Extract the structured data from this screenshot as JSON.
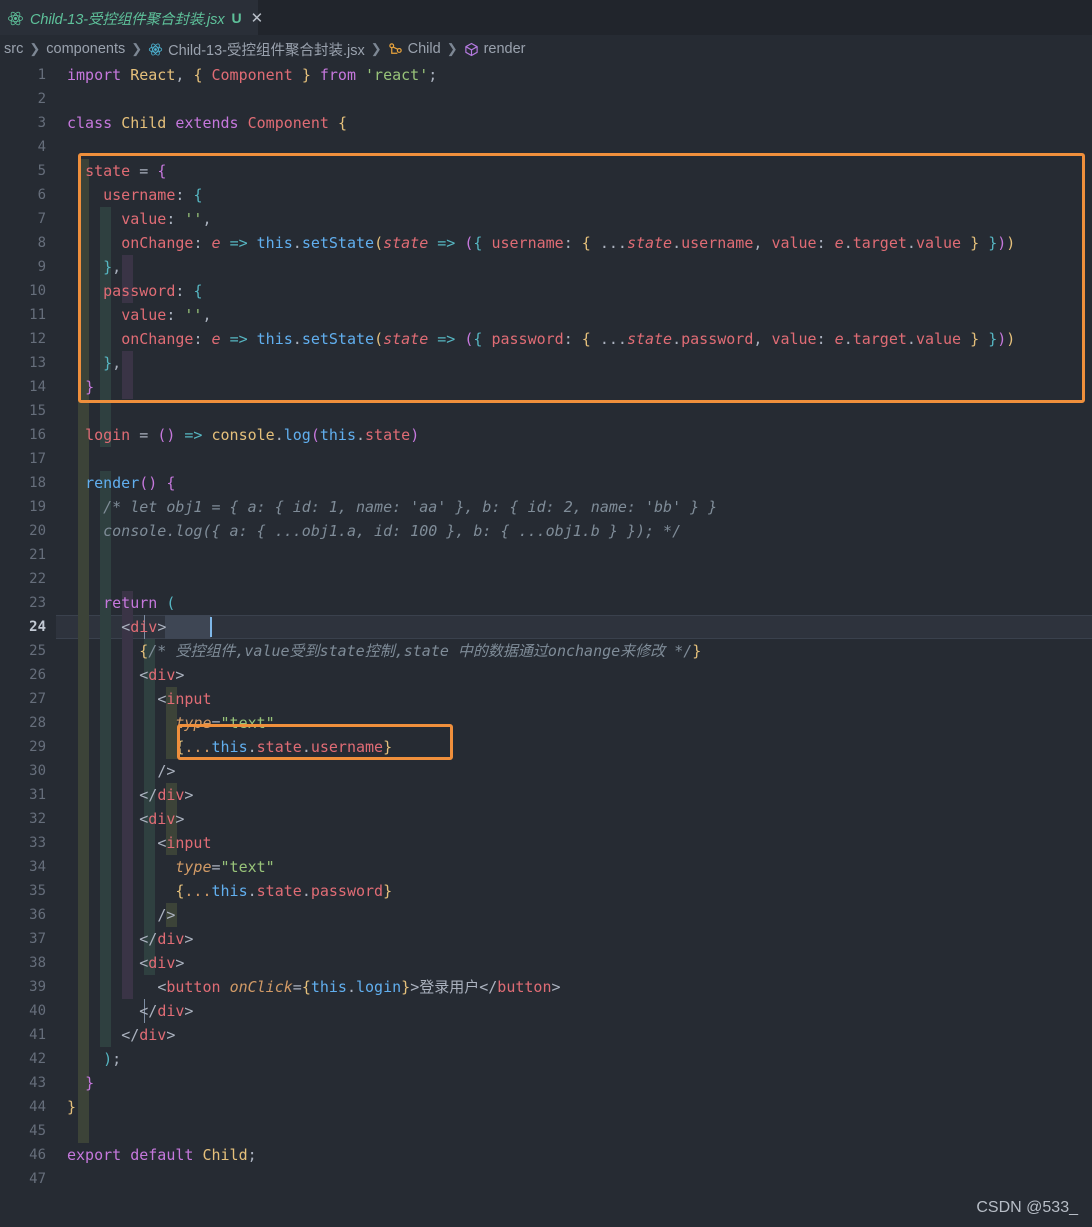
{
  "window": {
    "background": "#262b33",
    "accent_orange": "#ef8f3c"
  },
  "tab": {
    "icon": "react-icon",
    "label": "Child-13-受控组件聚合封装.jsx",
    "git_badge": "U",
    "close_label": "✕",
    "label_color": "#5ec19a"
  },
  "breadcrumb": {
    "items": [
      {
        "label": "src",
        "icon": null
      },
      {
        "label": "components",
        "icon": null
      },
      {
        "label": "Child-13-受控组件聚合封装.jsx",
        "icon": "react-icon"
      },
      {
        "label": "Child",
        "icon": "class-icon"
      },
      {
        "label": "render",
        "icon": "method-icon"
      }
    ],
    "separator": "❯"
  },
  "editor": {
    "active_line": 24,
    "line_numbers": [
      1,
      2,
      3,
      4,
      5,
      6,
      7,
      8,
      9,
      10,
      11,
      12,
      13,
      14,
      15,
      16,
      17,
      18,
      19,
      20,
      21,
      22,
      23,
      24,
      25,
      26,
      27,
      28,
      29,
      30,
      31,
      32,
      33,
      34,
      35,
      36,
      37,
      38,
      39,
      40,
      41,
      42,
      43,
      44,
      45,
      46,
      47
    ],
    "lines": [
      {
        "n": 1,
        "text": "import React, { Component } from 'react';"
      },
      {
        "n": 2,
        "text": ""
      },
      {
        "n": 3,
        "text": "class Child extends Component {"
      },
      {
        "n": 4,
        "text": ""
      },
      {
        "n": 5,
        "text": "  state = {"
      },
      {
        "n": 6,
        "text": "    username: {"
      },
      {
        "n": 7,
        "text": "      value: '',"
      },
      {
        "n": 8,
        "text": "      onChange: e => this.setState(state => ({ username: { ...state.username, value: e.target.value } }))"
      },
      {
        "n": 9,
        "text": "    },"
      },
      {
        "n": 10,
        "text": "    password: {"
      },
      {
        "n": 11,
        "text": "      value: '',"
      },
      {
        "n": 12,
        "text": "      onChange: e => this.setState(state => ({ password: { ...state.password, value: e.target.value } }))"
      },
      {
        "n": 13,
        "text": "    },"
      },
      {
        "n": 14,
        "text": "  }"
      },
      {
        "n": 15,
        "text": ""
      },
      {
        "n": 16,
        "text": "  login = () => console.log(this.state)"
      },
      {
        "n": 17,
        "text": ""
      },
      {
        "n": 18,
        "text": "  render() {"
      },
      {
        "n": 19,
        "text": "    /* let obj1 = { a: { id: 1, name: 'aa' }, b: { id: 2, name: 'bb' } }"
      },
      {
        "n": 20,
        "text": "    console.log({ a: { ...obj1.a, id: 100 }, b: { ...obj1.b } }); */"
      },
      {
        "n": 21,
        "text": ""
      },
      {
        "n": 22,
        "text": ""
      },
      {
        "n": 23,
        "text": "    return ("
      },
      {
        "n": 24,
        "text": "      <div>"
      },
      {
        "n": 25,
        "text": "        {/* 受控组件,value受到state控制,state 中的数据通过onchange来修改 */}"
      },
      {
        "n": 26,
        "text": "        <div>"
      },
      {
        "n": 27,
        "text": "          <input"
      },
      {
        "n": 28,
        "text": "            type=\"text\""
      },
      {
        "n": 29,
        "text": "            {...this.state.username}"
      },
      {
        "n": 30,
        "text": "          />"
      },
      {
        "n": 31,
        "text": "        </div>"
      },
      {
        "n": 32,
        "text": "        <div>"
      },
      {
        "n": 33,
        "text": "          <input"
      },
      {
        "n": 34,
        "text": "            type=\"text\""
      },
      {
        "n": 35,
        "text": "            {...this.state.password}"
      },
      {
        "n": 36,
        "text": "          />"
      },
      {
        "n": 37,
        "text": "        </div>"
      },
      {
        "n": 38,
        "text": "        <div>"
      },
      {
        "n": 39,
        "text": "          <button onClick={this.login}>登录用户</button>"
      },
      {
        "n": 40,
        "text": "        </div>"
      },
      {
        "n": 41,
        "text": "      </div>"
      },
      {
        "n": 42,
        "text": "    );"
      },
      {
        "n": 43,
        "text": "  }"
      },
      {
        "n": 44,
        "text": "}"
      },
      {
        "n": 45,
        "text": ""
      },
      {
        "n": 46,
        "text": "export default Child;"
      },
      {
        "n": 47,
        "text": ""
      }
    ]
  },
  "annotations": [
    {
      "name": "state-block-highlight",
      "lines": "5-14"
    },
    {
      "name": "username-spread-highlight",
      "lines": "29"
    }
  ],
  "watermark": {
    "text": "CSDN @533_"
  }
}
